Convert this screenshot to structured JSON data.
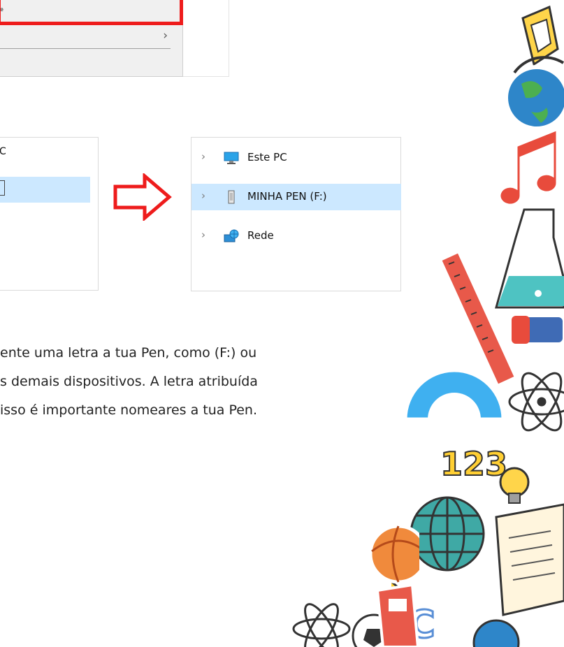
{
  "context_menu": {
    "partial_label": "e"
  },
  "left_pane": {
    "partial_label": "C"
  },
  "explorer_tree": {
    "items": [
      {
        "label": "Este PC",
        "icon": "monitor-icon",
        "selected": false
      },
      {
        "label": "MINHA PEN (F:)",
        "icon": "usb-drive-icon",
        "selected": true
      },
      {
        "label": "Rede",
        "icon": "network-icon",
        "selected": false
      }
    ]
  },
  "paragraph": {
    "lines": [
      "ente uma letra a tua Pen, como (F:) ou",
      "s demais dispositivos.  A letra atribuída",
      "isso é importante nomeares a tua Pen."
    ]
  },
  "decoration": {
    "numbers_label": "123",
    "letters_label": "ABC"
  },
  "colors": {
    "highlight_red": "#ee1c1c",
    "selection_blue": "#cce8ff"
  }
}
